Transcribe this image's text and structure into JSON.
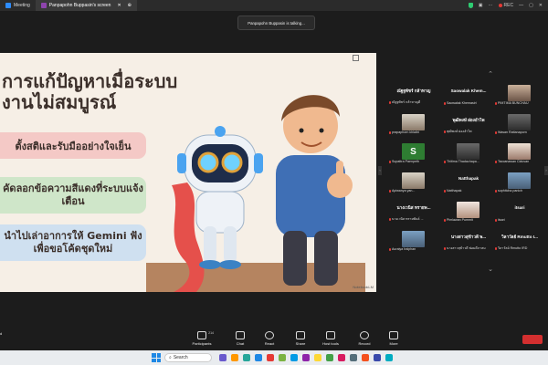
{
  "tabs": [
    {
      "label": "Meeting",
      "color": "#2d8cff"
    },
    {
      "label": "Panpapohn Buppasin's screen",
      "color": "#8e44ad"
    }
  ],
  "status": {
    "rec": "REC"
  },
  "talking": "Panpapohn Buppasin is talking...",
  "slide": {
    "title": "การแก้ปัญหาเมื่อระบบงานไม่สมบูรณ์",
    "points": [
      "ตั้งสติและรับมืออย่างใจเย็น",
      "คัดลอกข้อความสีแดงที่ระบบแจ้งเตือน",
      "นำไปเล่าอาการให้ Gemini ฟังเพื่อขอโค้ดชุดใหม่"
    ],
    "watermark": "NotebookLM"
  },
  "participants": [
    {
      "name": "ณัฐฐพัชร์ กล้าหาญ",
      "sub": "ณัฐฐพัชร์ กล้าหาญดี",
      "avatar": "none"
    },
    {
      "name": "Saowalak Khem...",
      "sub": "Saowalak Khemasiri",
      "avatar": "none"
    },
    {
      "name": "",
      "sub": "PIMTIMA BUNCHAU",
      "avatar": "p1"
    },
    {
      "name": "",
      "sub": "prapaphorn khlaibt",
      "avatar": "p4"
    },
    {
      "name": "พุฒิพงษ์ ผ่องอำไพ",
      "sub": "พุฒิพงษ์ ผ่องอำไพ",
      "avatar": "none"
    },
    {
      "name": "",
      "sub": "Wasan Rattanaporn",
      "avatar": "p3"
    },
    {
      "name": "",
      "sub": "Supattra Paenpeth",
      "avatar": "s"
    },
    {
      "name": "",
      "sub": "Thitima Thadachapa...",
      "avatar": "p3"
    },
    {
      "name": "",
      "sub": "Taccanawan Ciduvan",
      "avatar": "p2"
    },
    {
      "name": "",
      "sub": "Apiwanya yan...",
      "avatar": "p4"
    },
    {
      "name": "Natthapak",
      "sub": "Natthapak",
      "avatar": "none"
    },
    {
      "name": "",
      "sub": "suphitcha panich",
      "avatar": "p5"
    },
    {
      "name": "นางเวนิส ทรายพ...",
      "sub": "นางเวนิส ทรายพันธ์ ...",
      "avatar": "none"
    },
    {
      "name": "",
      "sub": "Pimlawan Pummit",
      "avatar": "p6"
    },
    {
      "name": "itsari",
      "sub": "itsari",
      "avatar": "none"
    },
    {
      "name": "",
      "sub": "Auraiya Iraiphan",
      "avatar": "p5"
    },
    {
      "name": "นางสาวสุข้าวดี พ...",
      "sub": "นางสาวสุข้าวดี พ่อมดีภาสม",
      "avatar": "none"
    },
    {
      "name": "วิลาวัลย์ Rmutto I...",
      "sub": "วิลาวัลย์ Rmutto IRD",
      "avatar": "none"
    }
  ],
  "controls": {
    "left_label": "d",
    "participants": {
      "label": "Participants",
      "count": "214"
    },
    "chat": "Chat",
    "react": "React",
    "share": "Share",
    "host_tools": "Host tools",
    "record": "Record",
    "more": "More"
  },
  "taskbar": {
    "search": "Search"
  }
}
